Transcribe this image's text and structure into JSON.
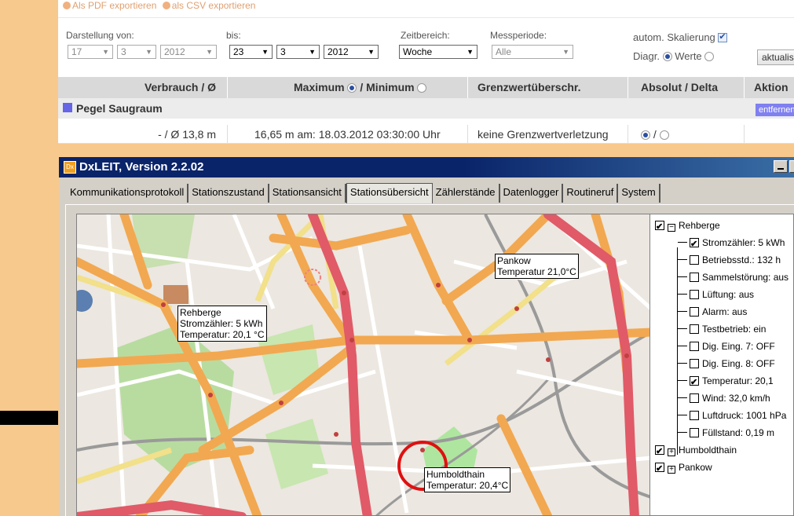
{
  "export": {
    "pdf": "Als PDF exportieren",
    "csv": "als CSV exportieren"
  },
  "filters": {
    "from_label": "Darstellung von:",
    "from_day": "17",
    "from_month": "3",
    "from_year": "2012",
    "to_label": "bis:",
    "to_day": "23",
    "to_month": "3",
    "to_year": "2012",
    "range_label": "Zeitbereich:",
    "range_value": "Woche",
    "period_label": "Messperiode:",
    "period_value": "Alle",
    "autoscale_label": "autom. Skalierung",
    "diag_label": "Diagr.",
    "values_label": "Werte",
    "update_button": "aktualisieren"
  },
  "table": {
    "headers": [
      "Verbrauch / Ø",
      "Maximum",
      "/ Minimum",
      "Grenzwertüberschr.",
      "Absolut / Delta",
      "Aktion"
    ],
    "row_name": "Pegel Saugraum",
    "remove_button": "entfernen",
    "row": {
      "consumption": "- / Ø 13,8 m",
      "maxmin": "16,65 m am: 18.03.2012 03:30:00 Uhr",
      "limit": "keine Grenzwertverletzung",
      "delta_sep": "/"
    }
  },
  "window": {
    "title": "DxLEIT, Version 2.2.02",
    "tabs": [
      "Kommunikationsprotokoll",
      "Stationszustand",
      "Stationsansicht",
      "Stationsübersicht",
      "Zählerstände",
      "Datenlogger",
      "Routineruf",
      "System"
    ],
    "active_tab": "Stationsübersicht"
  },
  "map_labels": {
    "rehberge": [
      "Rehberge",
      "Stromzähler: 5 kWh",
      "Temperatur: 20,1 °C"
    ],
    "pankow": [
      "Pankow",
      "Temperatur 21,0°C"
    ],
    "humboldthain": [
      "Humboldthain",
      "Temperatur: 20,4°C"
    ]
  },
  "tree": {
    "root": "Rehberge",
    "children": [
      {
        "label": "Stromzähler: 5 kWh",
        "checked": true
      },
      {
        "label": "Betriebsstd.: 132 h",
        "checked": false
      },
      {
        "label": "Sammelstörung: aus",
        "checked": false
      },
      {
        "label": "Lüftung: aus",
        "checked": false
      },
      {
        "label": "Alarm: aus",
        "checked": false
      },
      {
        "label": "Testbetrieb: ein",
        "checked": false
      },
      {
        "label": "Dig. Eing. 7: OFF",
        "checked": false
      },
      {
        "label": "Dig. Eing. 8: OFF",
        "checked": false
      },
      {
        "label": "Temperatur: 20,1",
        "checked": true
      },
      {
        "label": "Wind: 32,0 km/h",
        "checked": false
      },
      {
        "label": "Luftdruck: 1001 hPa",
        "checked": false
      },
      {
        "label": "Füllstand: 0,19 m",
        "checked": false
      }
    ],
    "siblings": [
      "Humboldthain",
      "Pankow"
    ]
  },
  "colors": {
    "accent": "#6565e6",
    "titlebar": "#0a246a",
    "background": "#f8c98c"
  }
}
